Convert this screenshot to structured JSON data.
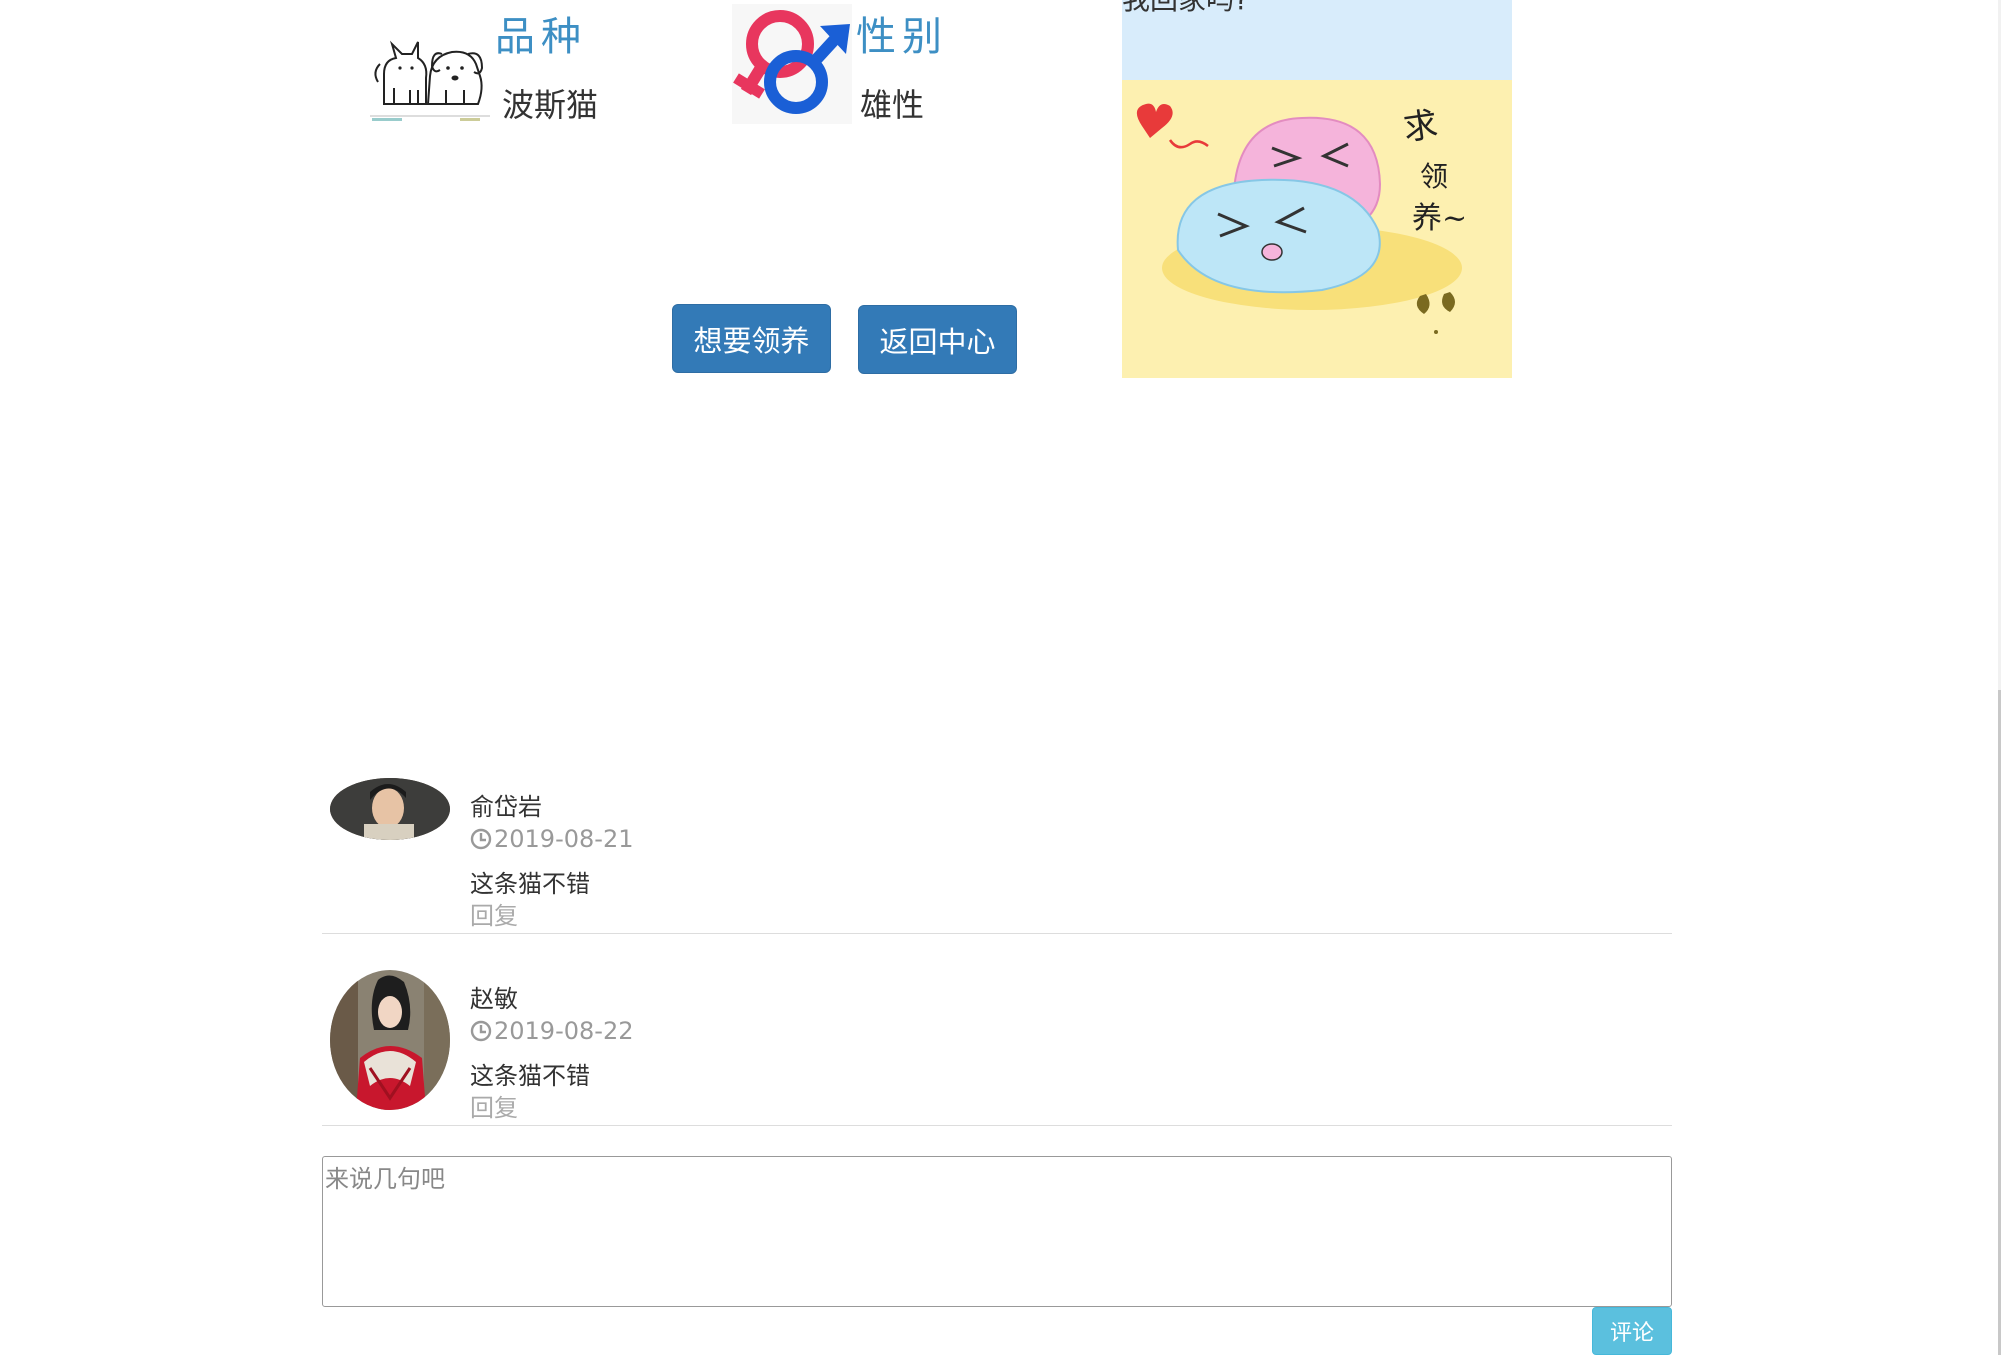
{
  "pet_info": {
    "breed": {
      "title": "品种",
      "value": "波斯猫",
      "icon": "cat-dog-icon"
    },
    "gender": {
      "title": "性别",
      "value": "雄性",
      "icon": "gender-symbol-icon"
    }
  },
  "actions": {
    "adopt_label": "想要领养",
    "back_label": "返回中心"
  },
  "adopt_panel": {
    "question": "我回家吗?",
    "art_text": [
      "求",
      "领",
      "养~"
    ]
  },
  "comments": [
    {
      "name": "俞岱岩",
      "date": "2019-08-21",
      "text": "这条猫不错",
      "reply_label": "回复"
    },
    {
      "name": "赵敏",
      "date": "2019-08-22",
      "text": "这条猫不错",
      "reply_label": "回复"
    }
  ],
  "comment_form": {
    "placeholder": "来说几句吧",
    "submit_label": "评论"
  },
  "colors": {
    "primary": "#337ab7",
    "info": "#5bc0de",
    "title_blue": "#3d8fc4"
  }
}
